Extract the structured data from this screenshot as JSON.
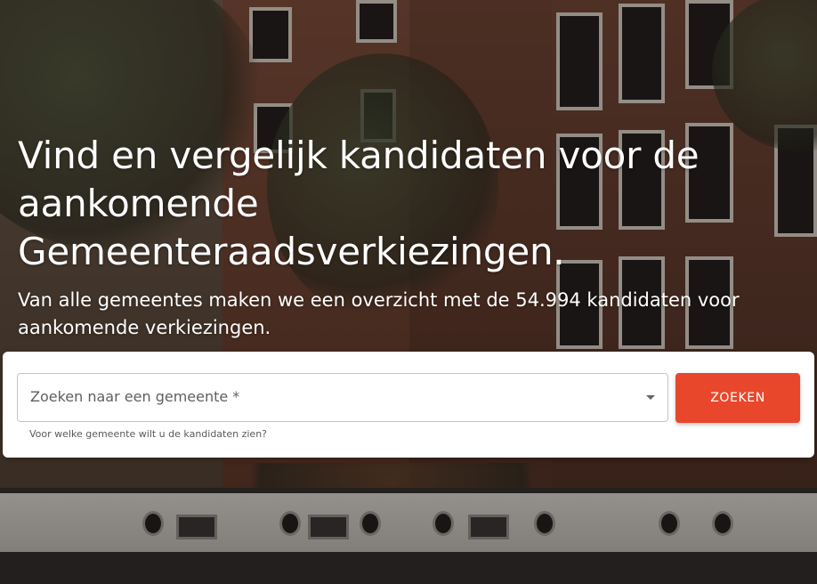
{
  "hero": {
    "background": "amsterdam-canal-houses-houseboat-photo",
    "headline": "Vind en vergelijk kandidaten voor de aankomende Gemeenteraadsverkiezingen.",
    "subline": "Van alle gemeentes maken we een overzicht met de 54.994 kandidaten voor aankomende verkiezingen."
  },
  "search": {
    "placeholder": "Zoeken naar een gemeente *",
    "dropdown_icon": "caret-down-icon",
    "helper_text": "Voor welke gemeente wilt u de kandidaten zien?",
    "button_label": "ZOEKEN"
  },
  "colors": {
    "accent": "#e8472b",
    "text_on_photo": "#ffffff",
    "card_background": "#ffffff"
  }
}
